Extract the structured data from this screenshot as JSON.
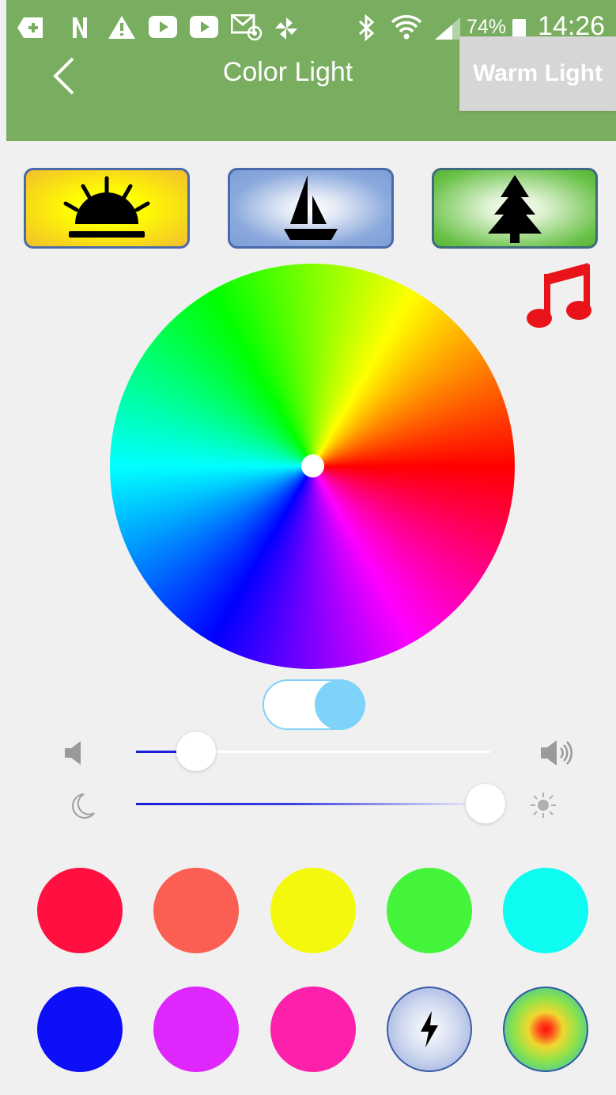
{
  "status_bar": {
    "icons": [
      "add-box-icon",
      "nfc-n-icon",
      "warning-icon",
      "youtube-icon",
      "youtube-icon",
      "email-at-icon",
      "pinwheel-icon",
      "bluetooth-icon",
      "wifi-icon",
      "signal-icon"
    ],
    "battery": "74%",
    "battery_level": 0.74,
    "time": "14:26"
  },
  "header": {
    "back_icon": "chevron-left-icon",
    "title": "Color Light",
    "warm_button": "Warm Light",
    "background_color": "#79ad5f"
  },
  "scenes": [
    {
      "name": "sunrise",
      "icon": "sunrise-icon"
    },
    {
      "name": "sailing",
      "icon": "sailboat-icon"
    },
    {
      "name": "forest",
      "icon": "pine-tree-icon"
    }
  ],
  "music": {
    "icon": "music-note-icon",
    "color": "#e8141a"
  },
  "color_wheel": {
    "selected_color": "#ffffff"
  },
  "power_toggle": {
    "on": true,
    "color": "#7fd2fa"
  },
  "volume_slider": {
    "value_fraction": 0.17,
    "min_icon": "speaker-icon",
    "max_icon": "speaker-loud-icon"
  },
  "brightness_slider": {
    "value_fraction": 0.99,
    "min_icon": "moon-icon",
    "max_icon": "sun-icon"
  },
  "swatches": [
    {
      "name": "red",
      "color": "#ff1040"
    },
    {
      "name": "coral",
      "color": "#fb5e52"
    },
    {
      "name": "yellow",
      "color": "#f4f80c"
    },
    {
      "name": "green",
      "color": "#44f43b"
    },
    {
      "name": "cyan",
      "color": "#0efbf1"
    },
    {
      "name": "blue",
      "color": "#0c0ff8"
    },
    {
      "name": "purple",
      "color": "#df26fc"
    },
    {
      "name": "magenta",
      "color": "#fc20aa"
    },
    {
      "name": "flash",
      "icon": "lightning-icon"
    },
    {
      "name": "gradient",
      "icon": "radial-gradient-icon"
    }
  ]
}
